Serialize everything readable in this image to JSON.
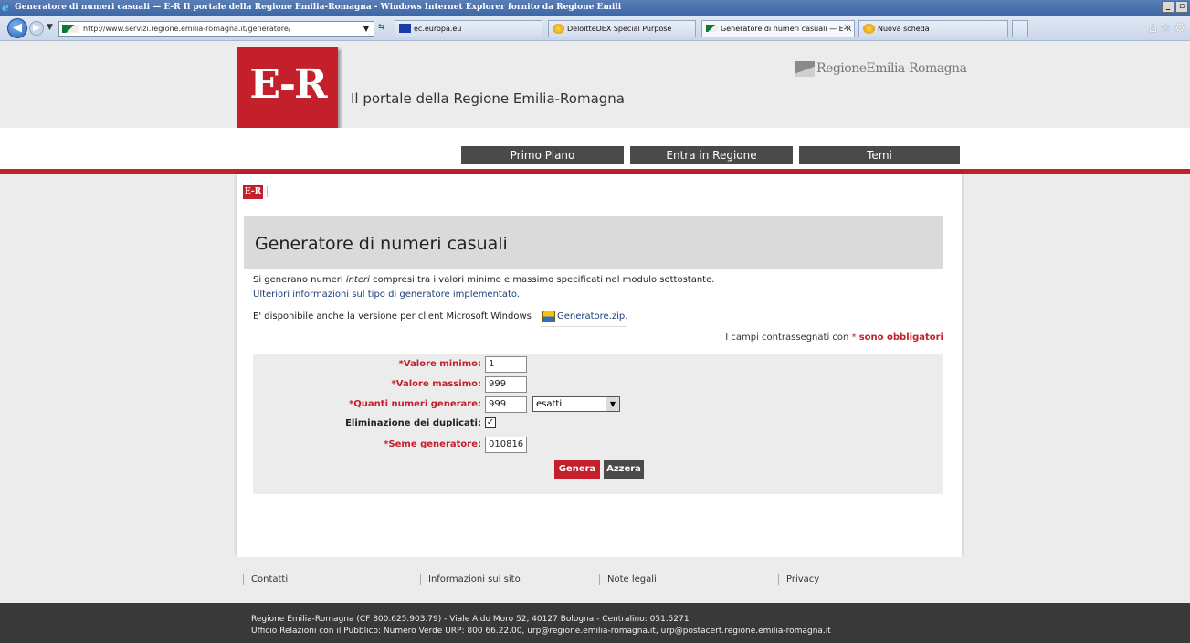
{
  "browser": {
    "window_title": "Generatore di numeri casuali — E-R Il portale della Regione Emilia-Romagna - Windows Internet Explorer fornito da Regione Emili",
    "address": "http://www.servizi.regione.emilia-romagna.it/generatore/",
    "tabs": [
      {
        "label": "ec.europa.eu"
      },
      {
        "label": "DeloitteDEX Special Purpose"
      },
      {
        "label": "Generatore di numeri casuali — E-R I..."
      },
      {
        "label": "Nuova scheda"
      }
    ]
  },
  "header": {
    "logo_text": "E-R",
    "portal_title": "Il portale della Regione Emilia-Romagna",
    "region_name": "RegioneEmilia-Romagna"
  },
  "menu": [
    "Primo Piano",
    "Entra in Regione",
    "Temi"
  ],
  "breadcrumb": {
    "home": "E-R"
  },
  "page": {
    "title": "Generatore di numeri casuali",
    "intro_before": "Si generano numeri ",
    "intro_em": "interi",
    "intro_after": " compresi tra i valori minimo e massimo specificati nel modulo sottostante.",
    "info_link": "Ulteriori informazioni sul tipo di generatore implementato.",
    "client_text": "E' disponibile anche la versione per client Microsoft Windows",
    "zip_link": "Generatore.zip.",
    "required_prefix": "I campi contrassegnati con",
    "required_star": "*",
    "required_suffix": "sono obbligatori"
  },
  "form": {
    "min_label": "*Valore minimo:",
    "min_value": "1",
    "max_label": "*Valore massimo:",
    "max_value": "999",
    "count_label": "*Quanti numeri generare:",
    "count_value": "999",
    "mode_selected": "esatti",
    "dedup_label": "Eliminazione dei duplicati:",
    "dedup_checked": true,
    "seed_label": "*Seme generatore:",
    "seed_value": "010816",
    "submit_label": "Genera",
    "reset_label": "Azzera"
  },
  "footer": {
    "links": [
      "Contatti",
      "Informazioni sul sito",
      "Note legali",
      "Privacy"
    ],
    "line1": "Regione Emilia-Romagna (CF 800.625.903.79) - Viale Aldo Moro 52, 40127 Bologna - Centralino: 051.5271",
    "line2_prefix": "Ufficio Relazioni con il Pubblico: Numero Verde URP: 800 66.22.00, ",
    "email1": "urp@regione.emilia-romagna.it",
    "line2_sep": ", ",
    "email2": "urp@postacert.regione.emilia-romagna.it"
  },
  "colors": {
    "brand_red": "#c4202b",
    "menu_dark": "#4a4a4a",
    "footer_dark": "#393939"
  },
  "icons": [
    "ie-logo-icon",
    "back-arrow-icon",
    "forward-arrow-icon",
    "refresh-icon",
    "zip-file-icon",
    "home-icon",
    "star-icon",
    "gear-icon"
  ]
}
